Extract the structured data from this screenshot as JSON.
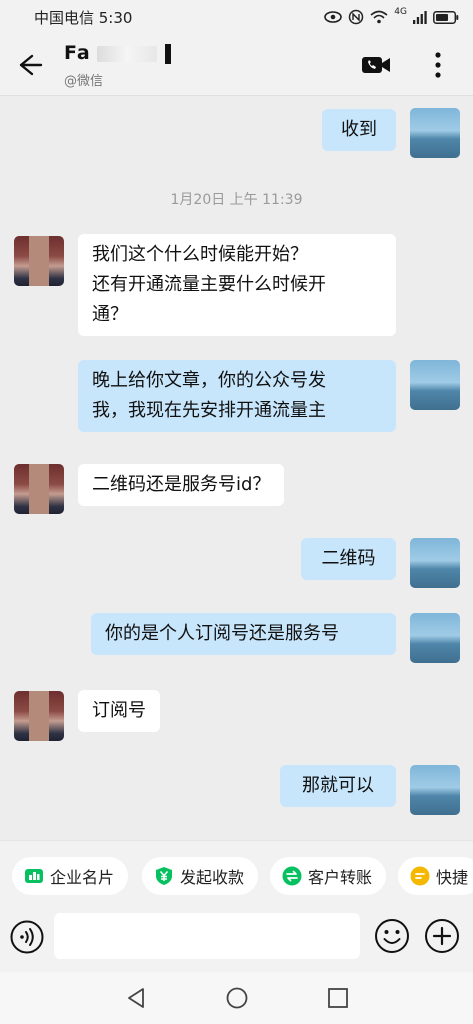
{
  "status": {
    "carrier_time": "中国电信 5:30",
    "signal_label": "4G"
  },
  "header": {
    "name": "Fa",
    "subtitle": "@微信"
  },
  "messages": [
    {
      "side": "out",
      "text": "收到"
    },
    {
      "side": "time",
      "text": "1月20日 上午 11:39"
    },
    {
      "side": "in",
      "lines": [
        "我们这个什么时候能开始？",
        "还有开通流量主要什么时候开",
        "通？"
      ]
    },
    {
      "side": "out",
      "lines": [
        "晚上给你文章，你的公众号发",
        "我，我现在先安排开通流量主"
      ]
    },
    {
      "side": "in",
      "text": "二维码还是服务号id？"
    },
    {
      "side": "out",
      "text": "二维码"
    },
    {
      "side": "out",
      "text": "你的是个人订阅号还是服务号"
    },
    {
      "side": "in",
      "text": "订阅号"
    },
    {
      "side": "out",
      "text": "那就可以"
    }
  ],
  "quick_actions": [
    {
      "label": "企业名片",
      "icon": "business-card-icon",
      "color": "#07c160"
    },
    {
      "label": "发起收款",
      "icon": "yuan-icon",
      "color": "#07c160"
    },
    {
      "label": "客户转账",
      "icon": "transfer-icon",
      "color": "#07c160"
    },
    {
      "label": "快捷",
      "icon": "quick-reply-icon",
      "color": "#f5b800"
    }
  ],
  "input": {
    "placeholder": "",
    "value": ""
  }
}
